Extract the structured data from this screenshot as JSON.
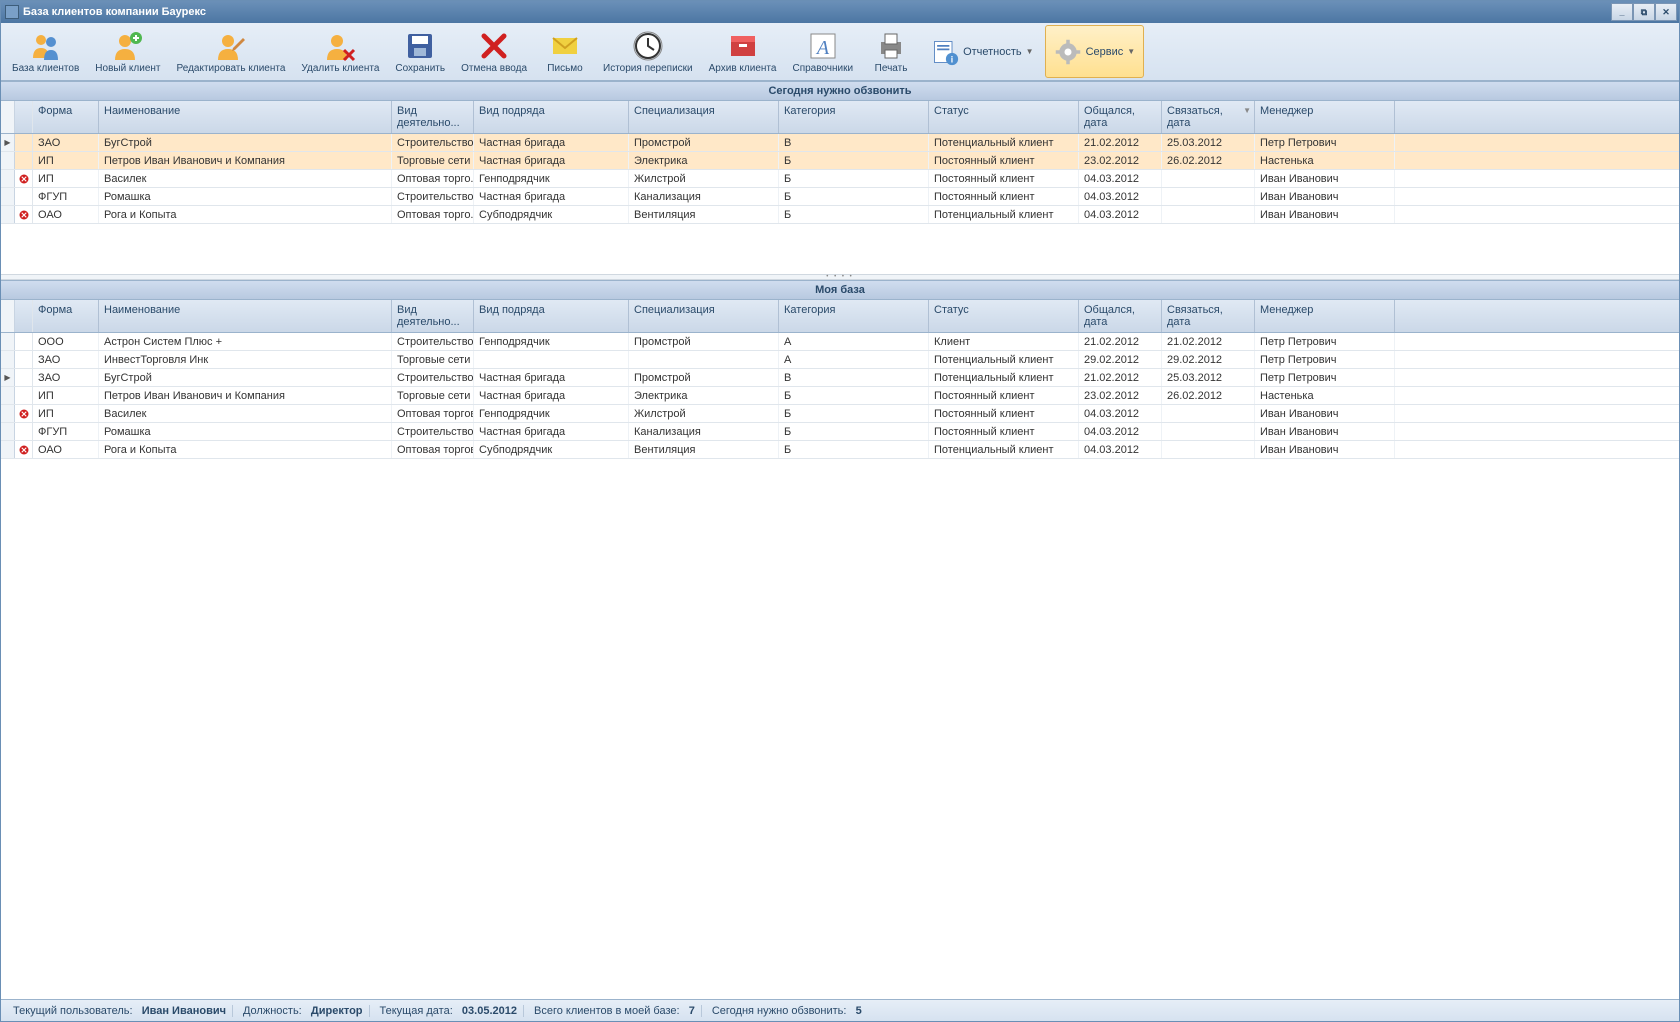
{
  "window": {
    "title": "База клиентов компании Баурекс"
  },
  "toolbar": {
    "clients_db": "База клиентов",
    "new_client": "Новый клиент",
    "edit_client": "Редактировать клиента",
    "delete_client": "Удалить клиента",
    "save": "Сохранить",
    "cancel": "Отмена ввода",
    "letter": "Письмо",
    "history": "История переписки",
    "archive": "Архив клиента",
    "refs": "Справочники",
    "print": "Печать",
    "reports": "Отчетность",
    "service": "Сервис"
  },
  "grid1": {
    "title": "Сегодня нужно обзвонить",
    "headers": {
      "form": "Форма",
      "name": "Наименование",
      "activity": "Вид деятельно...",
      "contract": "Вид подряда",
      "spec": "Специализация",
      "cat": "Категория",
      "status": "Статус",
      "date1": "Общался, дата",
      "date2": "Связаться, дата",
      "mgr": "Менеджер"
    },
    "rows": [
      {
        "ind": "▶",
        "flag": false,
        "form": "ЗАО",
        "name": "БугСтрой",
        "act": "Строительство",
        "contract": "Частная бригада",
        "spec": "Промстрой",
        "cat": "B",
        "status": "Потенциальный клиент",
        "d1": "21.02.2012",
        "d2": "25.03.2012",
        "mgr": "Петр Петрович",
        "hl": true
      },
      {
        "ind": "",
        "flag": false,
        "form": "ИП",
        "name": "Петров Иван Иванович и Компания",
        "act": "Торговые сети",
        "contract": "Частная бригада",
        "spec": "Электрика",
        "cat": "Б",
        "status": "Постоянный клиент",
        "d1": "23.02.2012",
        "d2": "26.02.2012",
        "mgr": "Настенька",
        "hl": true
      },
      {
        "ind": "",
        "flag": true,
        "form": "ИП",
        "name": "Василек",
        "act": "Оптовая торго...",
        "contract": "Генподрядчик",
        "spec": "Жилстрой",
        "cat": "Б",
        "status": "Постоянный клиент",
        "d1": "04.03.2012",
        "d2": "",
        "mgr": "Иван Иванович",
        "hl": false
      },
      {
        "ind": "",
        "flag": false,
        "form": "ФГУП",
        "name": "Ромашка",
        "act": "Строительство",
        "contract": "Частная бригада",
        "spec": "Канализация",
        "cat": "Б",
        "status": "Постоянный клиент",
        "d1": "04.03.2012",
        "d2": "",
        "mgr": "Иван Иванович",
        "hl": false
      },
      {
        "ind": "",
        "flag": true,
        "form": "ОАО",
        "name": "Рога и Копыта",
        "act": "Оптовая торго...",
        "contract": "Субподрядчик",
        "spec": "Вентиляция",
        "cat": "Б",
        "status": "Потенциальный клиент",
        "d1": "04.03.2012",
        "d2": "",
        "mgr": "Иван Иванович",
        "hl": false
      }
    ]
  },
  "grid2": {
    "title": "Моя база",
    "headers": {
      "form": "Форма",
      "name": "Наименование",
      "activity": "Вид деятельно...",
      "contract": "Вид подряда",
      "spec": "Специализация",
      "cat": "Категория",
      "status": "Статус",
      "date1": "Общался, дата",
      "date2": "Связаться, дата",
      "mgr": "Менеджер"
    },
    "rows": [
      {
        "ind": "",
        "flag": false,
        "form": "ООО",
        "name": "Астрон Систем Плюс +",
        "act": "Строительство",
        "contract": "Генподрядчик",
        "spec": "Промстрой",
        "cat": "A",
        "status": "Клиент",
        "d1": "21.02.2012",
        "d2": "21.02.2012",
        "mgr": "Петр Петрович"
      },
      {
        "ind": "",
        "flag": false,
        "form": "ЗАО",
        "name": "ИнвестТорговля Инк",
        "act": "Торговые сети",
        "contract": "",
        "spec": "",
        "cat": "A",
        "status": "Потенциальный клиент",
        "d1": "29.02.2012",
        "d2": "29.02.2012",
        "mgr": "Петр Петрович"
      },
      {
        "ind": "▶",
        "flag": false,
        "form": "ЗАО",
        "name": "БугСтрой",
        "act": "Строительство",
        "contract": "Частная бригада",
        "spec": "Промстрой",
        "cat": "B",
        "status": "Потенциальный клиент",
        "d1": "21.02.2012",
        "d2": "25.03.2012",
        "mgr": "Петр Петрович"
      },
      {
        "ind": "",
        "flag": false,
        "form": "ИП",
        "name": "Петров Иван Иванович и Компания",
        "act": "Торговые сети",
        "contract": "Частная бригада",
        "spec": "Электрика",
        "cat": "Б",
        "status": "Постоянный клиент",
        "d1": "23.02.2012",
        "d2": "26.02.2012",
        "mgr": "Настенька"
      },
      {
        "ind": "",
        "flag": true,
        "form": "ИП",
        "name": "Василек",
        "act": "Оптовая торговля",
        "contract": "Генподрядчик",
        "spec": "Жилстрой",
        "cat": "Б",
        "status": "Постоянный клиент",
        "d1": "04.03.2012",
        "d2": "",
        "mgr": "Иван Иванович"
      },
      {
        "ind": "",
        "flag": false,
        "form": "ФГУП",
        "name": "Ромашка",
        "act": "Строительство",
        "contract": "Частная бригада",
        "spec": "Канализация",
        "cat": "Б",
        "status": "Постоянный клиент",
        "d1": "04.03.2012",
        "d2": "",
        "mgr": "Иван Иванович"
      },
      {
        "ind": "",
        "flag": true,
        "form": "ОАО",
        "name": "Рога и Копыта",
        "act": "Оптовая торговля",
        "contract": "Субподрядчик",
        "spec": "Вентиляция",
        "cat": "Б",
        "status": "Потенциальный клиент",
        "d1": "04.03.2012",
        "d2": "",
        "mgr": "Иван Иванович"
      }
    ]
  },
  "statusbar": {
    "user_label": "Текущий пользователь:",
    "user": "Иван Иванович",
    "role_label": "Должность:",
    "role": "Директор",
    "date_label": "Текущая дата:",
    "date": "03.05.2012",
    "total_label": "Всего клиентов в моей базе:",
    "total": "7",
    "call_label": "Сегодня нужно обзвонить:",
    "call": "5"
  }
}
